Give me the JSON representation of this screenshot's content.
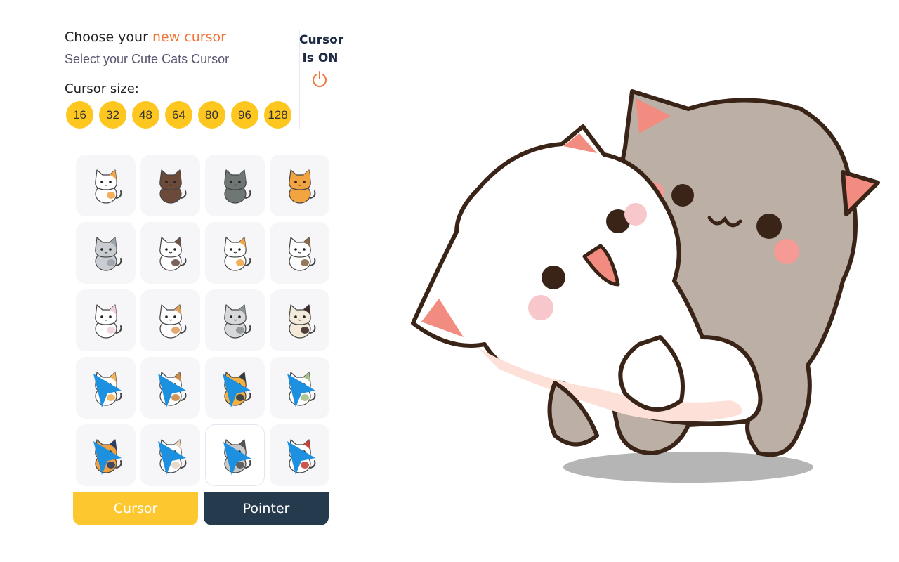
{
  "header": {
    "title_prefix": "Choose your ",
    "title_accent": "new cursor",
    "subtitle": "Select your Cute Cats Cursor"
  },
  "size_label": "Cursor size:",
  "sizes": [
    "16",
    "32",
    "48",
    "64",
    "80",
    "96",
    "128"
  ],
  "status": {
    "line1": "Cursor",
    "line2": "Is ON",
    "icon": "power-icon"
  },
  "cursors": [
    {
      "name": "calico-cat",
      "body": "#ffffff",
      "patch": "#f2a64a",
      "pointer": false
    },
    {
      "name": "brown-cat",
      "body": "#6b4a3a",
      "patch": "#6b4a3a",
      "pointer": false
    },
    {
      "name": "gray-cat",
      "body": "#6f7775",
      "patch": "#6f7775",
      "pointer": false
    },
    {
      "name": "orange-cat",
      "body": "#f2a440",
      "patch": "#f2a440",
      "pointer": false
    },
    {
      "name": "tabby-gray-cat",
      "body": "#c9cdd2",
      "patch": "#9aa2aa",
      "pointer": false
    },
    {
      "name": "patched-white-cat",
      "body": "#ffffff",
      "patch": "#6b5248",
      "pointer": false
    },
    {
      "name": "lying-calico-cat",
      "body": "#ffffff",
      "patch": "#f2a64a",
      "pointer": false
    },
    {
      "name": "tabby-brown-cat",
      "body": "#ffffff",
      "patch": "#8b6a4a",
      "pointer": false
    },
    {
      "name": "white-cat",
      "body": "#ffffff",
      "patch": "#f0d0d8",
      "pointer": false
    },
    {
      "name": "sitting-calico-cat",
      "body": "#ffffff",
      "patch": "#e0a060",
      "pointer": false
    },
    {
      "name": "silver-tabby-cat",
      "body": "#d6d8da",
      "patch": "#8d9296",
      "pointer": false
    },
    {
      "name": "siamese-cat",
      "body": "#f3ead9",
      "patch": "#3e2f2a",
      "pointer": false
    },
    {
      "name": "pointer-calico-cat",
      "body": "#ffffff",
      "patch": "#f2b45a",
      "pointer": true
    },
    {
      "name": "pointer-patch-cat",
      "body": "#ffffff",
      "patch": "#c98a48",
      "pointer": true
    },
    {
      "name": "pointer-police-cat",
      "body": "#f3b040",
      "patch": "#2f3b45",
      "pointer": true
    },
    {
      "name": "pointer-helmet-cat",
      "body": "#ffffff",
      "patch": "#a7c08a",
      "pointer": true
    },
    {
      "name": "pointer-pirate-cat",
      "body": "#f0a040",
      "patch": "#2c3d66",
      "pointer": true
    },
    {
      "name": "pointer-white-cat",
      "body": "#ffffff",
      "patch": "#e6d6c4",
      "pointer": true
    },
    {
      "name": "pointer-chef-cat",
      "body": "#c8c8c8",
      "patch": "#555555",
      "pointer": true,
      "selected": true
    },
    {
      "name": "pointer-mustache-cat",
      "body": "#ffffff",
      "patch": "#c8433a",
      "pointer": true
    }
  ],
  "tabs": {
    "cursor": "Cursor",
    "pointer": "Pointer"
  },
  "colors": {
    "accent_orange": "#f2763a",
    "size_yellow": "#fdc71f",
    "tab_yellow": "#fdc72f",
    "tab_navy": "#263a4e",
    "status_navy": "#1f2a44"
  }
}
